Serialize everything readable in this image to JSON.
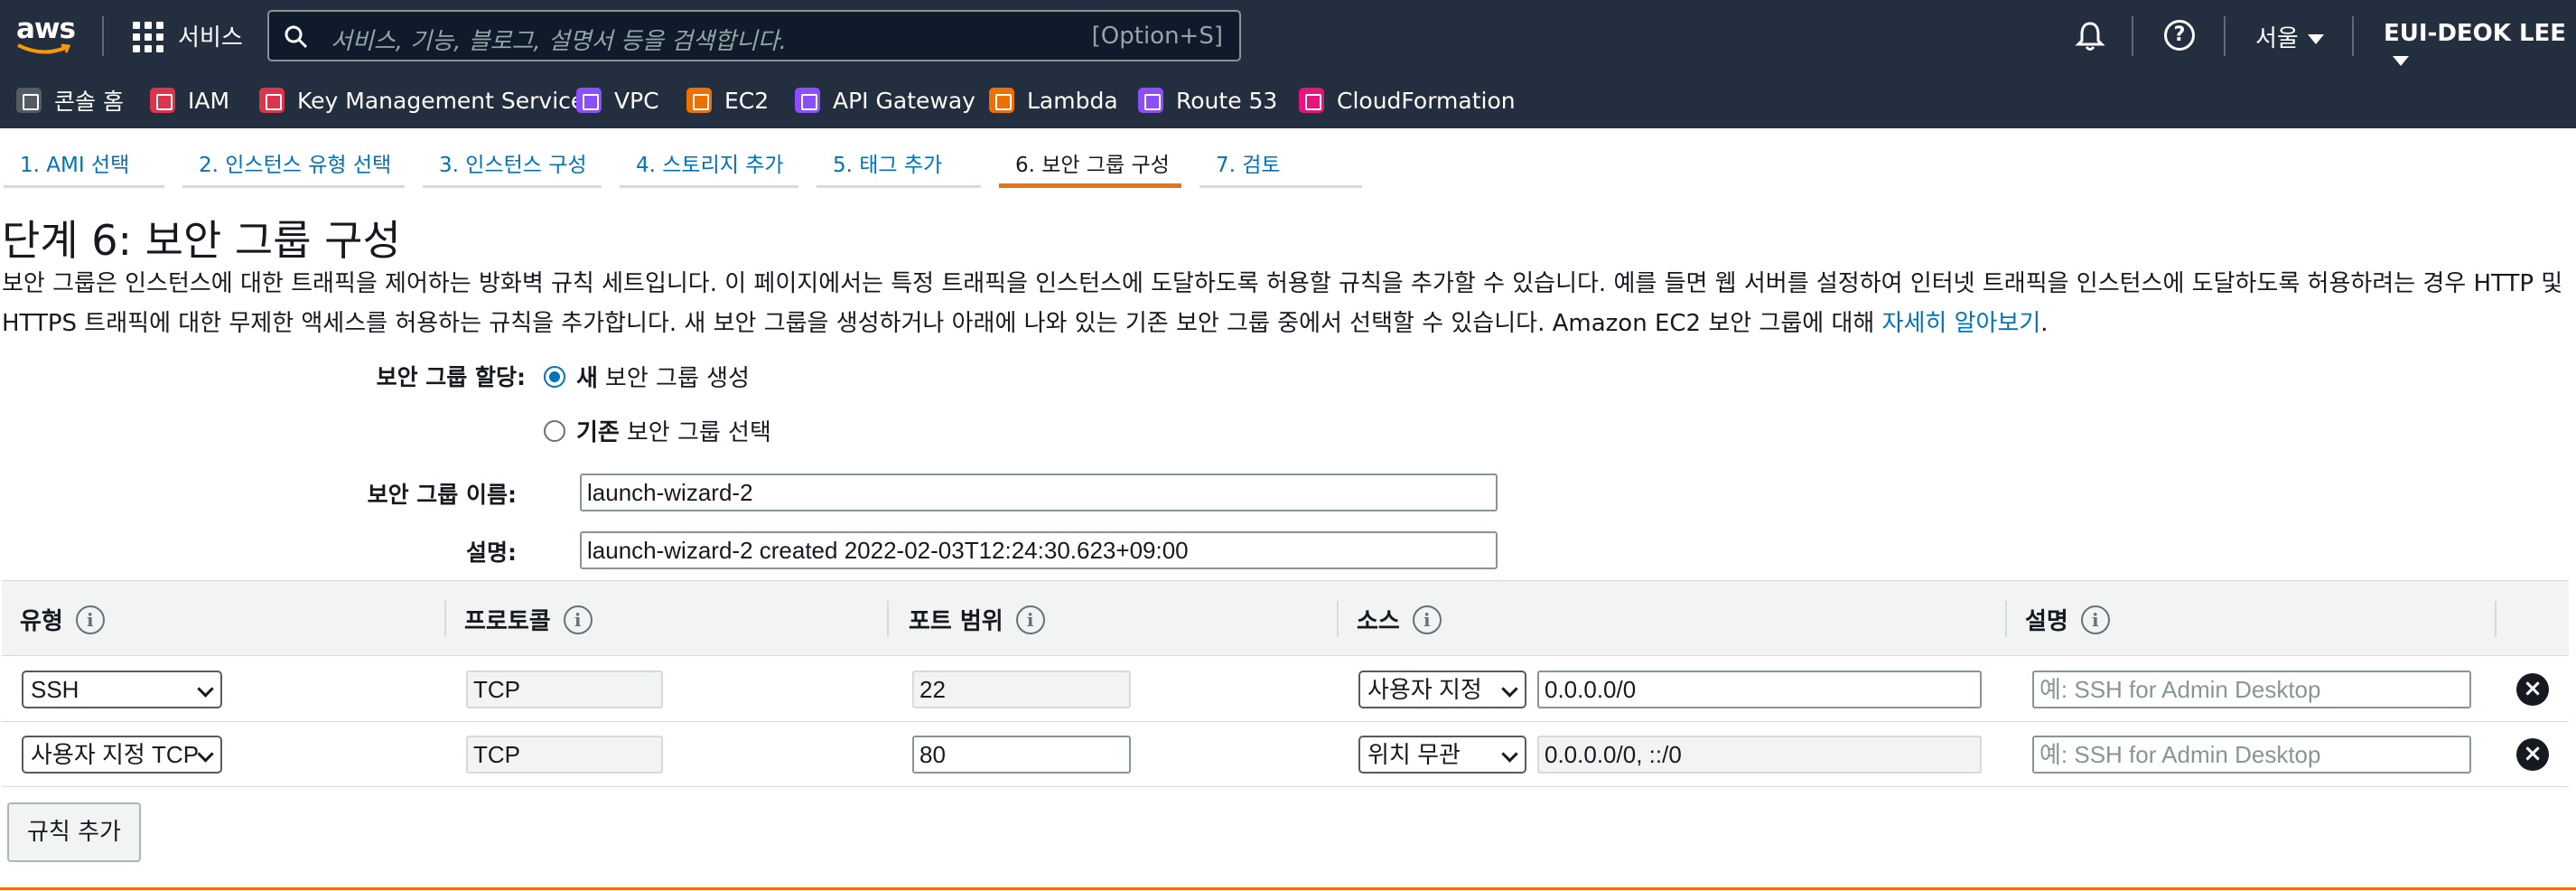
{
  "header": {
    "logo_text": "aws",
    "services_label": "서비스",
    "search_placeholder": "서비스, 기능, 블로그, 설명서 등을 검색합니다.",
    "search_shortcut": "[Option+S]",
    "region": "서울",
    "user": "EUI-DEOK LEE"
  },
  "favorites": [
    {
      "label": "콘솔 홈",
      "color": "#545b64",
      "icon": "cube-icon"
    },
    {
      "label": "IAM",
      "color": "#dd344c",
      "icon": "iam-icon"
    },
    {
      "label": "Key Management Service",
      "color": "#dd344c",
      "icon": "kms-icon"
    },
    {
      "label": "VPC",
      "color": "#8c4fff",
      "icon": "vpc-icon"
    },
    {
      "label": "EC2",
      "color": "#ed7100",
      "icon": "ec2-icon"
    },
    {
      "label": "API Gateway",
      "color": "#8c4fff",
      "icon": "api-gateway-icon"
    },
    {
      "label": "Lambda",
      "color": "#ed7100",
      "icon": "lambda-icon"
    },
    {
      "label": "Route 53",
      "color": "#8c4fff",
      "icon": "route53-icon"
    },
    {
      "label": "CloudFormation",
      "color": "#e7157b",
      "icon": "cloudformation-icon"
    }
  ],
  "wizard_tabs": [
    "1. AMI 선택",
    "2. 인스턴스 유형 선택",
    "3. 인스턴스 구성",
    "4. 스토리지 추가",
    "5. 태그 추가",
    "6. 보안 그룹 구성",
    "7. 검토"
  ],
  "active_tab_index": 5,
  "page": {
    "title": "단계 6: 보안 그룹 구성",
    "description": "보안 그룹은 인스턴스에 대한 트래픽을 제어하는 방화벽 규칙 세트입니다. 이 페이지에서는 특정 트래픽을 인스턴스에 도달하도록 허용할 규칙을 추가할 수 있습니다. 예를 들면 웹 서버를 설정하여 인터넷 트래픽을 인스턴스에 도달하도록 허용하려는 경우 HTTP 및 HTTPS 트래픽에 대한 무제한 액세스를 허용하는 규칙을 추가합니다. 새 보안 그룹을 생성하거나 아래에 나와 있는 기존 보안 그룹 중에서 선택할 수 있습니다. Amazon EC2 보안 그룹에 대해 ",
    "learn_more": "자세히 알아보기",
    "period": "."
  },
  "form": {
    "assign_label": "보안 그룹 할당:",
    "radio_new_bold": "새",
    "radio_new_rest": "보안 그룹 생성",
    "radio_existing_bold": "기존",
    "radio_existing_rest": "보안 그룹 선택",
    "name_label": "보안 그룹 이름:",
    "name_value": "launch-wizard-2",
    "desc_label": "설명:",
    "desc_value": "launch-wizard-2 created 2022-02-03T12:24:30.623+09:00"
  },
  "table": {
    "headers": [
      "유형",
      "프로토콜",
      "포트 범위",
      "소스",
      "설명"
    ],
    "rows": [
      {
        "type": "SSH",
        "protocol": "TCP",
        "port": "22",
        "source_mode": "사용자 지정",
        "source": "0.0.0.0/0",
        "desc_placeholder": "예: SSH for Admin Desktop"
      },
      {
        "type": "사용자 지정 TCP",
        "protocol": "TCP",
        "port": "80",
        "source_mode": "위치 무관",
        "source": "0.0.0.0/0, ::/0",
        "desc_placeholder": "예: SSH for Admin Desktop"
      }
    ],
    "add_rule": "규칙 추가"
  }
}
